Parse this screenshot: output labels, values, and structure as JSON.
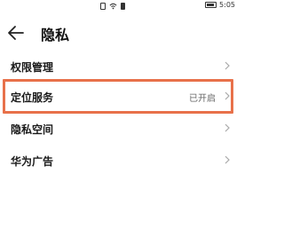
{
  "status_bar": {
    "time": "5:05",
    "icons": [
      "sim-icon",
      "wifi-icon",
      "battery-small-icon",
      "battery-icon"
    ]
  },
  "header": {
    "back_icon": "arrow-left-icon",
    "title": "隐私"
  },
  "items": [
    {
      "label": "权限管理",
      "value": ""
    },
    {
      "label": "定位服务",
      "value": "已开启"
    },
    {
      "label": "隐私空间",
      "value": ""
    },
    {
      "label": "华为广告",
      "value": ""
    }
  ],
  "colors": {
    "highlight": "#e8714a",
    "text": "#1a1a1a",
    "secondary": "#666666"
  }
}
